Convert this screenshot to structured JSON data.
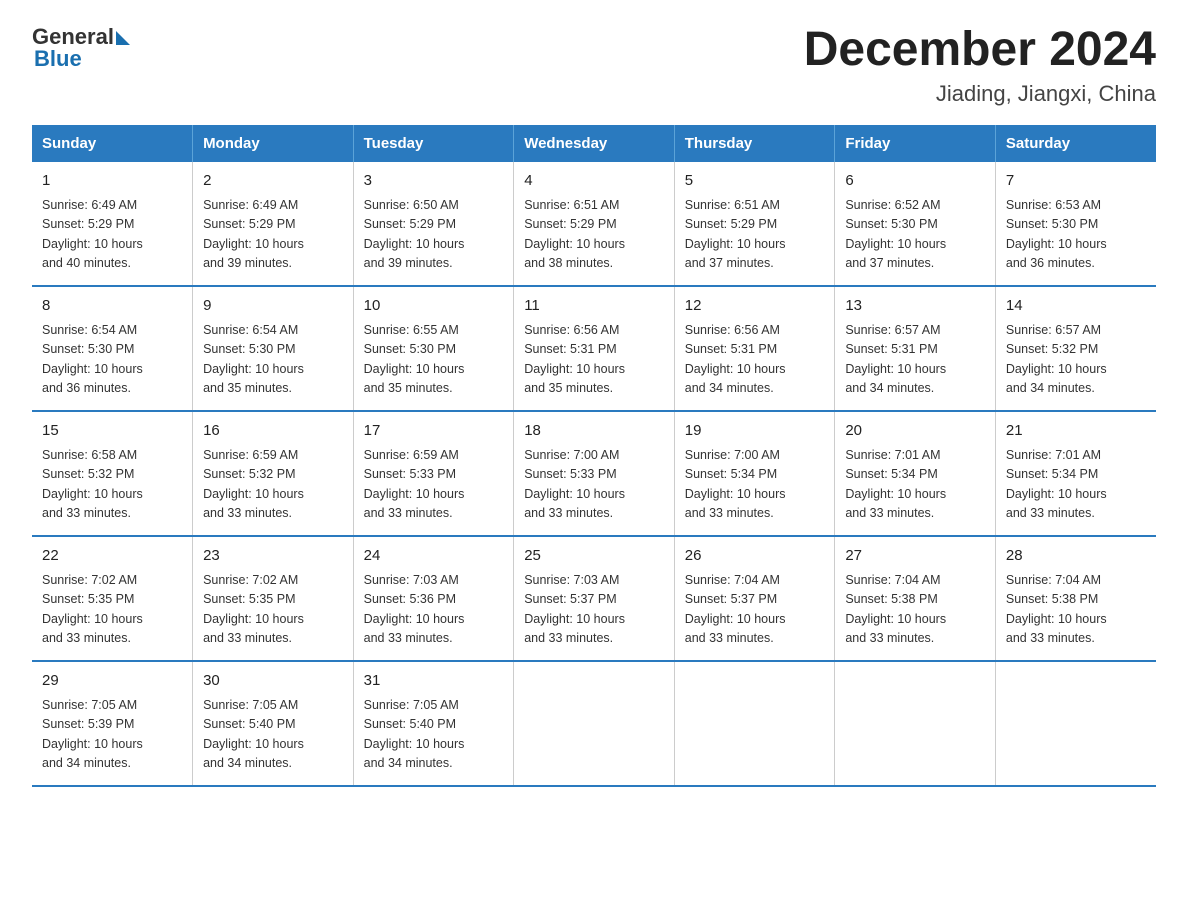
{
  "header": {
    "logo_general": "General",
    "logo_blue": "Blue",
    "title": "December 2024",
    "subtitle": "Jiading, Jiangxi, China"
  },
  "weekdays": [
    "Sunday",
    "Monday",
    "Tuesday",
    "Wednesday",
    "Thursday",
    "Friday",
    "Saturday"
  ],
  "weeks": [
    [
      {
        "day": "1",
        "sunrise": "6:49 AM",
        "sunset": "5:29 PM",
        "daylight": "10 hours and 40 minutes."
      },
      {
        "day": "2",
        "sunrise": "6:49 AM",
        "sunset": "5:29 PM",
        "daylight": "10 hours and 39 minutes."
      },
      {
        "day": "3",
        "sunrise": "6:50 AM",
        "sunset": "5:29 PM",
        "daylight": "10 hours and 39 minutes."
      },
      {
        "day": "4",
        "sunrise": "6:51 AM",
        "sunset": "5:29 PM",
        "daylight": "10 hours and 38 minutes."
      },
      {
        "day": "5",
        "sunrise": "6:51 AM",
        "sunset": "5:29 PM",
        "daylight": "10 hours and 37 minutes."
      },
      {
        "day": "6",
        "sunrise": "6:52 AM",
        "sunset": "5:30 PM",
        "daylight": "10 hours and 37 minutes."
      },
      {
        "day": "7",
        "sunrise": "6:53 AM",
        "sunset": "5:30 PM",
        "daylight": "10 hours and 36 minutes."
      }
    ],
    [
      {
        "day": "8",
        "sunrise": "6:54 AM",
        "sunset": "5:30 PM",
        "daylight": "10 hours and 36 minutes."
      },
      {
        "day": "9",
        "sunrise": "6:54 AM",
        "sunset": "5:30 PM",
        "daylight": "10 hours and 35 minutes."
      },
      {
        "day": "10",
        "sunrise": "6:55 AM",
        "sunset": "5:30 PM",
        "daylight": "10 hours and 35 minutes."
      },
      {
        "day": "11",
        "sunrise": "6:56 AM",
        "sunset": "5:31 PM",
        "daylight": "10 hours and 35 minutes."
      },
      {
        "day": "12",
        "sunrise": "6:56 AM",
        "sunset": "5:31 PM",
        "daylight": "10 hours and 34 minutes."
      },
      {
        "day": "13",
        "sunrise": "6:57 AM",
        "sunset": "5:31 PM",
        "daylight": "10 hours and 34 minutes."
      },
      {
        "day": "14",
        "sunrise": "6:57 AM",
        "sunset": "5:32 PM",
        "daylight": "10 hours and 34 minutes."
      }
    ],
    [
      {
        "day": "15",
        "sunrise": "6:58 AM",
        "sunset": "5:32 PM",
        "daylight": "10 hours and 33 minutes."
      },
      {
        "day": "16",
        "sunrise": "6:59 AM",
        "sunset": "5:32 PM",
        "daylight": "10 hours and 33 minutes."
      },
      {
        "day": "17",
        "sunrise": "6:59 AM",
        "sunset": "5:33 PM",
        "daylight": "10 hours and 33 minutes."
      },
      {
        "day": "18",
        "sunrise": "7:00 AM",
        "sunset": "5:33 PM",
        "daylight": "10 hours and 33 minutes."
      },
      {
        "day": "19",
        "sunrise": "7:00 AM",
        "sunset": "5:34 PM",
        "daylight": "10 hours and 33 minutes."
      },
      {
        "day": "20",
        "sunrise": "7:01 AM",
        "sunset": "5:34 PM",
        "daylight": "10 hours and 33 minutes."
      },
      {
        "day": "21",
        "sunrise": "7:01 AM",
        "sunset": "5:34 PM",
        "daylight": "10 hours and 33 minutes."
      }
    ],
    [
      {
        "day": "22",
        "sunrise": "7:02 AM",
        "sunset": "5:35 PM",
        "daylight": "10 hours and 33 minutes."
      },
      {
        "day": "23",
        "sunrise": "7:02 AM",
        "sunset": "5:35 PM",
        "daylight": "10 hours and 33 minutes."
      },
      {
        "day": "24",
        "sunrise": "7:03 AM",
        "sunset": "5:36 PM",
        "daylight": "10 hours and 33 minutes."
      },
      {
        "day": "25",
        "sunrise": "7:03 AM",
        "sunset": "5:37 PM",
        "daylight": "10 hours and 33 minutes."
      },
      {
        "day": "26",
        "sunrise": "7:04 AM",
        "sunset": "5:37 PM",
        "daylight": "10 hours and 33 minutes."
      },
      {
        "day": "27",
        "sunrise": "7:04 AM",
        "sunset": "5:38 PM",
        "daylight": "10 hours and 33 minutes."
      },
      {
        "day": "28",
        "sunrise": "7:04 AM",
        "sunset": "5:38 PM",
        "daylight": "10 hours and 33 minutes."
      }
    ],
    [
      {
        "day": "29",
        "sunrise": "7:05 AM",
        "sunset": "5:39 PM",
        "daylight": "10 hours and 34 minutes."
      },
      {
        "day": "30",
        "sunrise": "7:05 AM",
        "sunset": "5:40 PM",
        "daylight": "10 hours and 34 minutes."
      },
      {
        "day": "31",
        "sunrise": "7:05 AM",
        "sunset": "5:40 PM",
        "daylight": "10 hours and 34 minutes."
      },
      null,
      null,
      null,
      null
    ]
  ],
  "labels": {
    "sunrise": "Sunrise:",
    "sunset": "Sunset:",
    "daylight": "Daylight:"
  }
}
